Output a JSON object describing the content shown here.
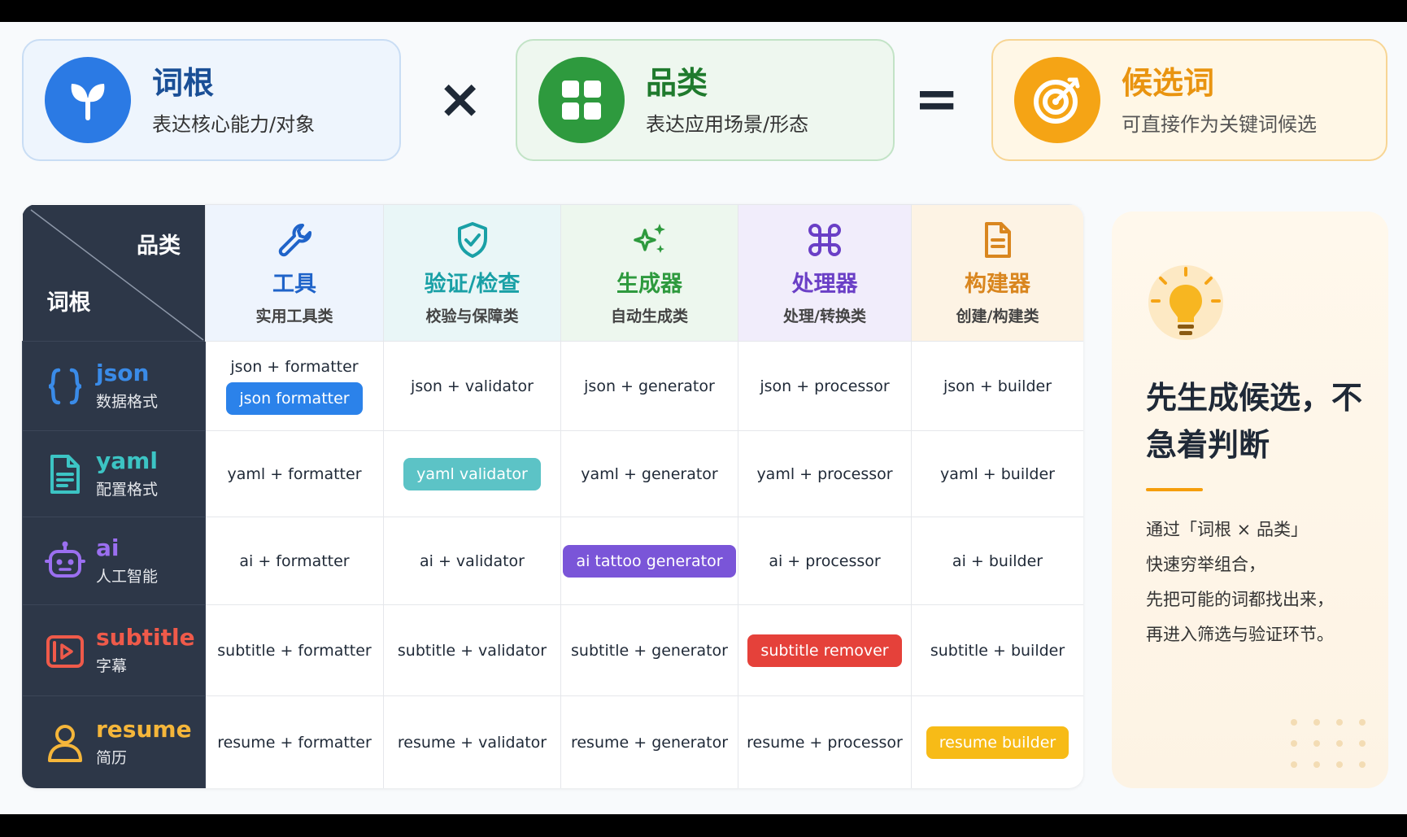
{
  "formula": {
    "root": {
      "title": "词根",
      "sub": "表达核心能力/对象",
      "color": "#2b7ae4",
      "icon": "sprout-icon"
    },
    "times": "×",
    "category": {
      "title": "品类",
      "sub": "表达应用场景/形态",
      "color": "#2e9a3e",
      "icon": "grid-icon"
    },
    "equals": "=",
    "candidate": {
      "title": "候选词",
      "sub": "可直接作为关键词候选",
      "color": "#f5a415",
      "icon": "target-icon"
    }
  },
  "grid": {
    "corner_category": "品类",
    "corner_root": "词根",
    "columns": [
      {
        "name": "工具",
        "desc": "实用工具类",
        "color": "#1f63c9",
        "bg": "#eef4fd",
        "icon": "wrench-icon"
      },
      {
        "name": "验证/检查",
        "desc": "校验与保障类",
        "color": "#19a0a6",
        "bg": "#e9f6f7",
        "icon": "shield-check-icon"
      },
      {
        "name": "生成器",
        "desc": "自动生成类",
        "color": "#2e9a3e",
        "bg": "#edf7ee",
        "icon": "sparkles-icon"
      },
      {
        "name": "处理器",
        "desc": "处理/转换类",
        "color": "#6a3fc6",
        "bg": "#f1edfb",
        "icon": "command-icon"
      },
      {
        "name": "构建器",
        "desc": "创建/构建类",
        "color": "#d9861f",
        "bg": "#fdf3e4",
        "icon": "document-icon"
      }
    ],
    "rows": [
      {
        "name": "json",
        "desc": "数据格式",
        "color": "#3a8be8",
        "icon": "braces-icon",
        "cells": [
          "json + formatter",
          "json + validator",
          "json + generator",
          "json + processor",
          "json + builder"
        ],
        "highlight": {
          "col": 0,
          "label": "json formatter",
          "color": "#2b82ea"
        }
      },
      {
        "name": "yaml",
        "desc": "配置格式",
        "color": "#3cc4c4",
        "icon": "file-text-icon",
        "cells": [
          "yaml + formatter",
          "yaml validator",
          "yaml + generator",
          "yaml + processor",
          "yaml + builder"
        ],
        "highlight": {
          "col": 1,
          "label": "yaml validator",
          "color": "#5cc3c6"
        }
      },
      {
        "name": "ai",
        "desc": "人工智能",
        "color": "#9b6ff0",
        "icon": "robot-icon",
        "cells": [
          "ai + formatter",
          "ai + validator",
          "ai tattoo generator",
          "ai + processor",
          "ai + builder"
        ],
        "highlight": {
          "col": 2,
          "label": "ai tattoo generator",
          "color": "#7a55d8"
        }
      },
      {
        "name": "subtitle",
        "desc": "字幕",
        "color": "#ef5a4a",
        "icon": "play-frame-icon",
        "cells": [
          "subtitle + formatter",
          "subtitle + validator",
          "subtitle + generator",
          "subtitle remover",
          "subtitle + builder"
        ],
        "highlight": {
          "col": 3,
          "label": "subtitle remover",
          "color": "#e5413a"
        }
      },
      {
        "name": "resume",
        "desc": "简历",
        "color": "#f5b63a",
        "icon": "person-icon",
        "cells": [
          "resume + formatter",
          "resume + validator",
          "resume + generator",
          "resume + processor",
          "resume builder"
        ],
        "highlight": {
          "col": 4,
          "label": "resume builder",
          "color": "#f7bb17"
        }
      }
    ]
  },
  "side": {
    "icon": "lightbulb-icon",
    "title": "先生成候选，不急着判断",
    "lines": [
      "通过「词根 × 品类」",
      "快速穷举组合，",
      "先把可能的词都找出来，",
      "再进入筛选与验证环节。"
    ]
  }
}
